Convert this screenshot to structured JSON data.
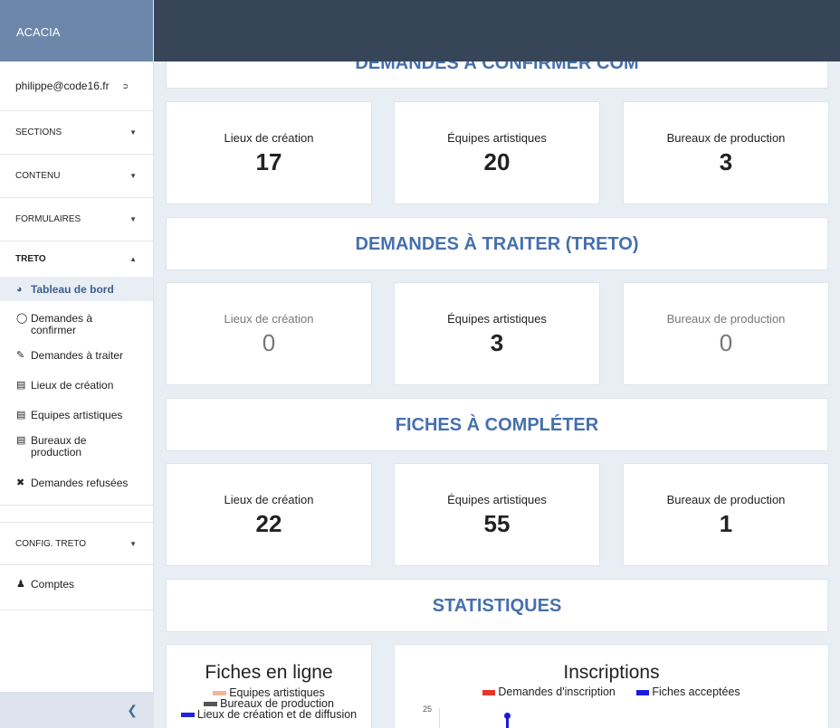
{
  "app": {
    "brand": "ACACIA"
  },
  "sidebar": {
    "user_email": "philippe@code16.fr",
    "logout_icon": "logout-icon",
    "sections": [
      {
        "label": "SECTIONS"
      },
      {
        "label": "CONTENU"
      },
      {
        "label": "FORMULAIRES"
      },
      {
        "label": "TRETO"
      }
    ],
    "treto_items": [
      {
        "label": "Tableau de bord",
        "icon": "dashboard-icon"
      },
      {
        "label": "Demandes à confirmer",
        "icon": "chat-bubble-icon"
      },
      {
        "label": "Demandes à traiter",
        "icon": "pencil-icon"
      },
      {
        "label": "Lieux de création",
        "icon": "id-card-icon"
      },
      {
        "label": "Equipes artistiques",
        "icon": "id-card-icon"
      },
      {
        "label": "Bureaux de production",
        "icon": "id-card-icon"
      },
      {
        "label": "Demandes refusées",
        "icon": "times-icon"
      }
    ],
    "config_label": "CONFIG. TRETO",
    "comptes_label": "Comptes",
    "collapse_icon": "chevron-left-icon"
  },
  "dashboard": {
    "sections": [
      {
        "title": "DEMANDES À CONFIRMER COM",
        "cards": [
          {
            "label": "Lieux de création",
            "value": "17"
          },
          {
            "label": "Équipes artistiques",
            "value": "20"
          },
          {
            "label": "Bureaux de production",
            "value": "3"
          }
        ]
      },
      {
        "title": "DEMANDES À TRAITER (TRETO)",
        "cards": [
          {
            "label": "Lieux de création",
            "value": "0"
          },
          {
            "label": "Équipes artistiques",
            "value": "3"
          },
          {
            "label": "Bureaux de production",
            "value": "0"
          }
        ]
      },
      {
        "title": "FICHES À COMPLÉTER",
        "cards": [
          {
            "label": "Lieux de création",
            "value": "22"
          },
          {
            "label": "Équipes artistiques",
            "value": "55"
          },
          {
            "label": "Bureaux de production",
            "value": "1"
          }
        ]
      }
    ],
    "stats_title": "STATISTIQUES",
    "fiches_chart": {
      "title": "Fiches en ligne",
      "legend": [
        "Equipes artistiques",
        "Bureaux de production",
        "Lieux de création et de diffusion"
      ]
    },
    "inscriptions_chart": {
      "title": "Inscriptions",
      "legend": [
        "Demandes d'inscription",
        "Fiches acceptées"
      ],
      "y_tick": "25"
    }
  },
  "colors": {
    "brand": "#6c87a9",
    "topbar": "#374558",
    "accent": "#4670ad",
    "legend_equipes": "#f3b597",
    "legend_bureaux": "#555555",
    "legend_lieux": "#2222dd",
    "legend_demandes": "#e8352a",
    "legend_fiches": "#1a1ae0"
  }
}
